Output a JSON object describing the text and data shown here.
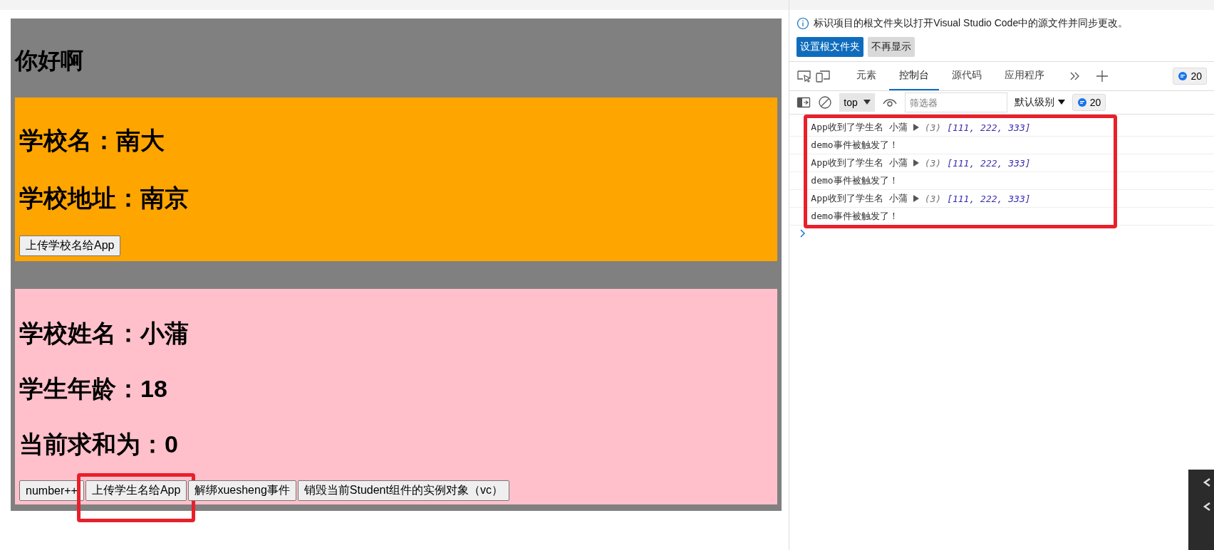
{
  "page": {
    "heading": "你好啊",
    "school": {
      "lines": [
        "学校名：南大",
        "学校地址：南京"
      ],
      "button": "上传学校名给App"
    },
    "student": {
      "lines": [
        "学校姓名：小蒲",
        "学生年龄：18",
        "当前求和为：0"
      ],
      "buttons": [
        {
          "label": "number++",
          "highlighted": false
        },
        {
          "label": "上传学生名给App",
          "highlighted": true
        },
        {
          "label": "解绑xuesheng事件",
          "highlighted": false
        },
        {
          "label": "销毁当前Student组件的实例对象（vc）",
          "highlighted": false
        }
      ]
    }
  },
  "devtools": {
    "banner": {
      "message": "标识项目的根文件夹以打开Visual Studio Code中的源文件并同步更改。",
      "buttons": [
        {
          "label": "设置根文件夹",
          "kind": "primary"
        },
        {
          "label": "不再显示",
          "kind": "secondary"
        }
      ]
    },
    "tabs": [
      {
        "label": "元素",
        "selected": false
      },
      {
        "label": "控制台",
        "selected": true
      },
      {
        "label": "源代码",
        "selected": false
      },
      {
        "label": "应用程序",
        "selected": false
      }
    ],
    "message_count": "20",
    "toolbar": {
      "context": "top",
      "filter_placeholder": "筛选器",
      "level": "默认级别",
      "count": "20"
    },
    "console": {
      "highlighted": true,
      "messages": [
        {
          "kind": "array",
          "text": "App收到了学生名 小蒲",
          "length": "(3)",
          "array": "[111, 222, 333]"
        },
        {
          "kind": "text",
          "text": "demo事件被触发了！"
        },
        {
          "kind": "array",
          "text": "App收到了学生名 小蒲",
          "length": "(3)",
          "array": "[111, 222, 333]"
        },
        {
          "kind": "text",
          "text": "demo事件被触发了！"
        },
        {
          "kind": "array",
          "text": "App收到了学生名 小蒲",
          "length": "(3)",
          "array": "[111, 222, 333]"
        },
        {
          "kind": "text",
          "text": "demo事件被触发了！"
        }
      ]
    }
  }
}
